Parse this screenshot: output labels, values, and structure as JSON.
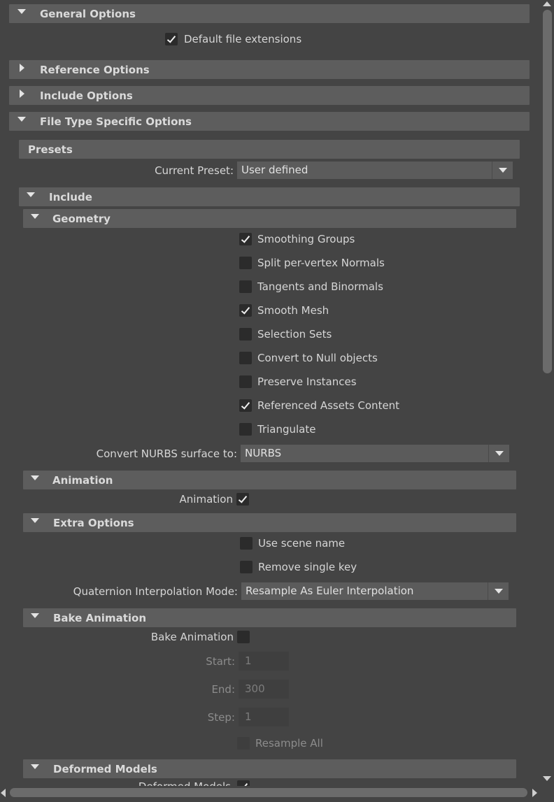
{
  "sections": {
    "general": "General Options",
    "reference": "Reference Options",
    "include_options": "Include Options",
    "file_type": "File Type Specific Options",
    "presets": "Presets",
    "include": "Include",
    "geometry": "Geometry",
    "animation": "Animation",
    "extra": "Extra Options",
    "bake": "Bake Animation",
    "deformed": "Deformed Models"
  },
  "general": {
    "default_ext": "Default file extensions"
  },
  "presets": {
    "label": "Current Preset:",
    "value": "User defined"
  },
  "geometry": {
    "items": [
      {
        "label": "Smoothing Groups",
        "checked": true
      },
      {
        "label": "Split per-vertex Normals",
        "checked": false
      },
      {
        "label": "Tangents and Binormals",
        "checked": false
      },
      {
        "label": "Smooth Mesh",
        "checked": true
      },
      {
        "label": "Selection Sets",
        "checked": false
      },
      {
        "label": "Convert to Null objects",
        "checked": false
      },
      {
        "label": "Preserve Instances",
        "checked": false
      },
      {
        "label": "Referenced Assets Content",
        "checked": true
      },
      {
        "label": "Triangulate",
        "checked": false
      }
    ],
    "nurbs_label": "Convert NURBS surface to:",
    "nurbs_value": "NURBS"
  },
  "animation": {
    "label": "Animation"
  },
  "extra": {
    "use_scene_name": "Use scene name",
    "remove_single_key": "Remove single key",
    "quat_label": "Quaternion Interpolation Mode:",
    "quat_value": "Resample As Euler Interpolation"
  },
  "bake": {
    "label": "Bake Animation",
    "start_label": "Start:",
    "start_value": "1",
    "end_label": "End:",
    "end_value": "300",
    "step_label": "Step:",
    "step_value": "1",
    "resample_all": "Resample All"
  },
  "deformed": {
    "partial_label": "Deformed Models"
  }
}
